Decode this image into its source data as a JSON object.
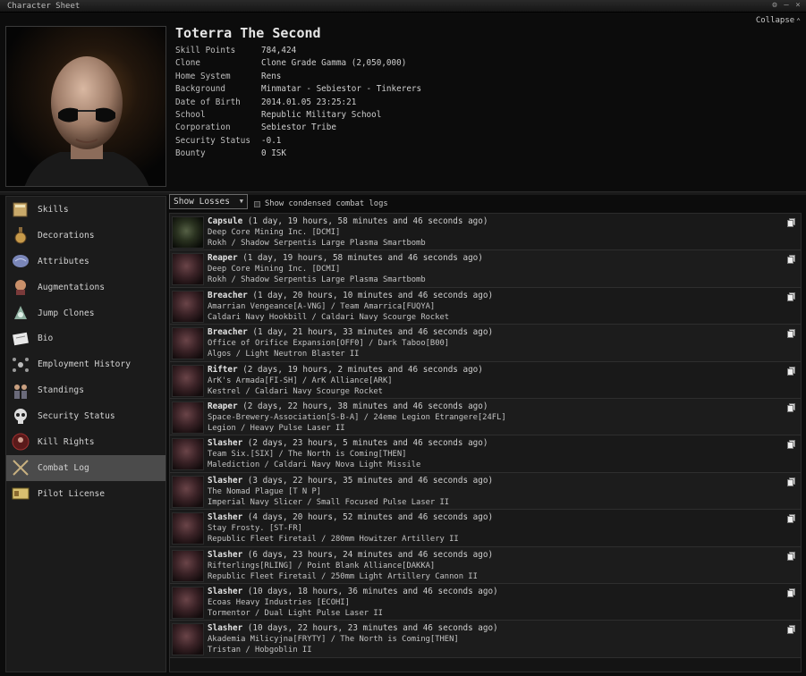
{
  "window": {
    "title": "Character Sheet",
    "collapse_label": "Collapse"
  },
  "character": {
    "name": "Toterra The Second",
    "fields": [
      {
        "key": "Skill Points",
        "value": "784,424"
      },
      {
        "key": "Clone",
        "value": "Clone Grade Gamma (2,050,000)"
      },
      {
        "key": "Home System",
        "value": "Rens"
      },
      {
        "key": "Background",
        "value": "Minmatar - Sebiestor - Tinkerers"
      },
      {
        "key": "Date of Birth",
        "value": "2014.01.05 23:25:21"
      },
      {
        "key": "School",
        "value": "Republic Military School"
      },
      {
        "key": "Corporation",
        "value": "Sebiestor Tribe"
      },
      {
        "key": "Security Status",
        "value": "-0.1"
      },
      {
        "key": "Bounty",
        "value": "0 ISK"
      }
    ]
  },
  "sidebar": {
    "items": [
      {
        "label": "Skills",
        "icon": "skills-book-icon"
      },
      {
        "label": "Decorations",
        "icon": "decorations-medal-icon"
      },
      {
        "label": "Attributes",
        "icon": "attributes-brain-icon"
      },
      {
        "label": "Augmentations",
        "icon": "augmentations-implant-icon"
      },
      {
        "label": "Jump Clones",
        "icon": "jump-clones-icon"
      },
      {
        "label": "Bio",
        "icon": "bio-document-icon"
      },
      {
        "label": "Employment History",
        "icon": "employment-history-icon"
      },
      {
        "label": "Standings",
        "icon": "standings-icon"
      },
      {
        "label": "Security Status",
        "icon": "security-status-skull-icon"
      },
      {
        "label": "Kill Rights",
        "icon": "kill-rights-icon"
      },
      {
        "label": "Combat Log",
        "icon": "combat-log-swords-icon"
      },
      {
        "label": "Pilot License",
        "icon": "pilot-license-card-icon"
      }
    ],
    "active": "Combat Log"
  },
  "toolbar": {
    "dropdown_value": "Show Losses",
    "checkbox_label": "Show condensed combat logs",
    "checkbox_checked": false
  },
  "combat_log": [
    {
      "ship": "Capsule",
      "time": "(1 day, 19 hours, 58 minutes and 46 seconds ago)",
      "line2": "Deep Core Mining Inc. [DCMI]",
      "line3": "Rokh / Shadow Serpentis Large Plasma Smartbomb",
      "thumb": "capsule"
    },
    {
      "ship": "Reaper",
      "time": "(1 day, 19 hours, 58 minutes and 46 seconds ago)",
      "line2": "Deep Core Mining Inc. [DCMI]",
      "line3": "Rokh / Shadow Serpentis Large Plasma Smartbomb",
      "thumb": "ship"
    },
    {
      "ship": "Breacher",
      "time": "(1 day, 20 hours, 10 minutes and 46 seconds ago)",
      "line2": "Amarrian Vengeance[A-VNG] / Team Amarrica[FUQYA]",
      "line3": "Caldari Navy Hookbill / Caldari Navy Scourge Rocket",
      "thumb": "ship"
    },
    {
      "ship": "Breacher",
      "time": "(1 day, 21 hours, 33 minutes and 46 seconds ago)",
      "line2": "Office of Orifice Expansion[OFF0] / Dark Taboo[B00]",
      "line3": "Algos / Light Neutron Blaster II",
      "thumb": "ship"
    },
    {
      "ship": "Rifter",
      "time": "(2 days, 19 hours, 2 minutes and 46 seconds ago)",
      "line2": "ArK's Armada[FI-SH] / ArK Alliance[ARK]",
      "line3": "Kestrel / Caldari Navy Scourge Rocket",
      "thumb": "ship"
    },
    {
      "ship": "Reaper",
      "time": "(2 days, 22 hours, 38 minutes and 46 seconds ago)",
      "line2": "Space-Brewery-Association[S-B-A] / 24eme Legion Etrangere[24FL]",
      "line3": "Legion / Heavy Pulse Laser II",
      "thumb": "ship"
    },
    {
      "ship": "Slasher",
      "time": "(2 days, 23 hours, 5 minutes and 46 seconds ago)",
      "line2": "Team Six.[SIX] / The North is Coming[THEN]",
      "line3": "Malediction / Caldari Navy Nova Light Missile",
      "thumb": "ship"
    },
    {
      "ship": "Slasher",
      "time": "(3 days, 22 hours, 35 minutes and 46 seconds ago)",
      "line2": "The Nomad Plague [T N P]",
      "line3": "Imperial Navy Slicer / Small Focused Pulse Laser II",
      "thumb": "ship"
    },
    {
      "ship": "Slasher",
      "time": "(4 days, 20 hours, 52 minutes and 46 seconds ago)",
      "line2": "Stay Frosty. [ST-FR]",
      "line3": "Republic Fleet Firetail / 280mm Howitzer Artillery II",
      "thumb": "ship"
    },
    {
      "ship": "Slasher",
      "time": "(6 days, 23 hours, 24 minutes and 46 seconds ago)",
      "line2": "Rifterlings[RLING] / Point Blank Alliance[DAKKA]",
      "line3": "Republic Fleet Firetail / 250mm Light Artillery Cannon II",
      "thumb": "ship"
    },
    {
      "ship": "Slasher",
      "time": "(10 days, 18 hours, 36 minutes and 46 seconds ago)",
      "line2": "Ecoas Heavy Industries [ECOHI]",
      "line3": "Tormentor / Dual Light Pulse Laser II",
      "thumb": "ship"
    },
    {
      "ship": "Slasher",
      "time": "(10 days, 22 hours, 23 minutes and 46 seconds ago)",
      "line2": "Akademia Milicyjna[FRYTY] / The North is Coming[THEN]",
      "line3": "Tristan / Hobgoblin II",
      "thumb": "ship"
    }
  ]
}
